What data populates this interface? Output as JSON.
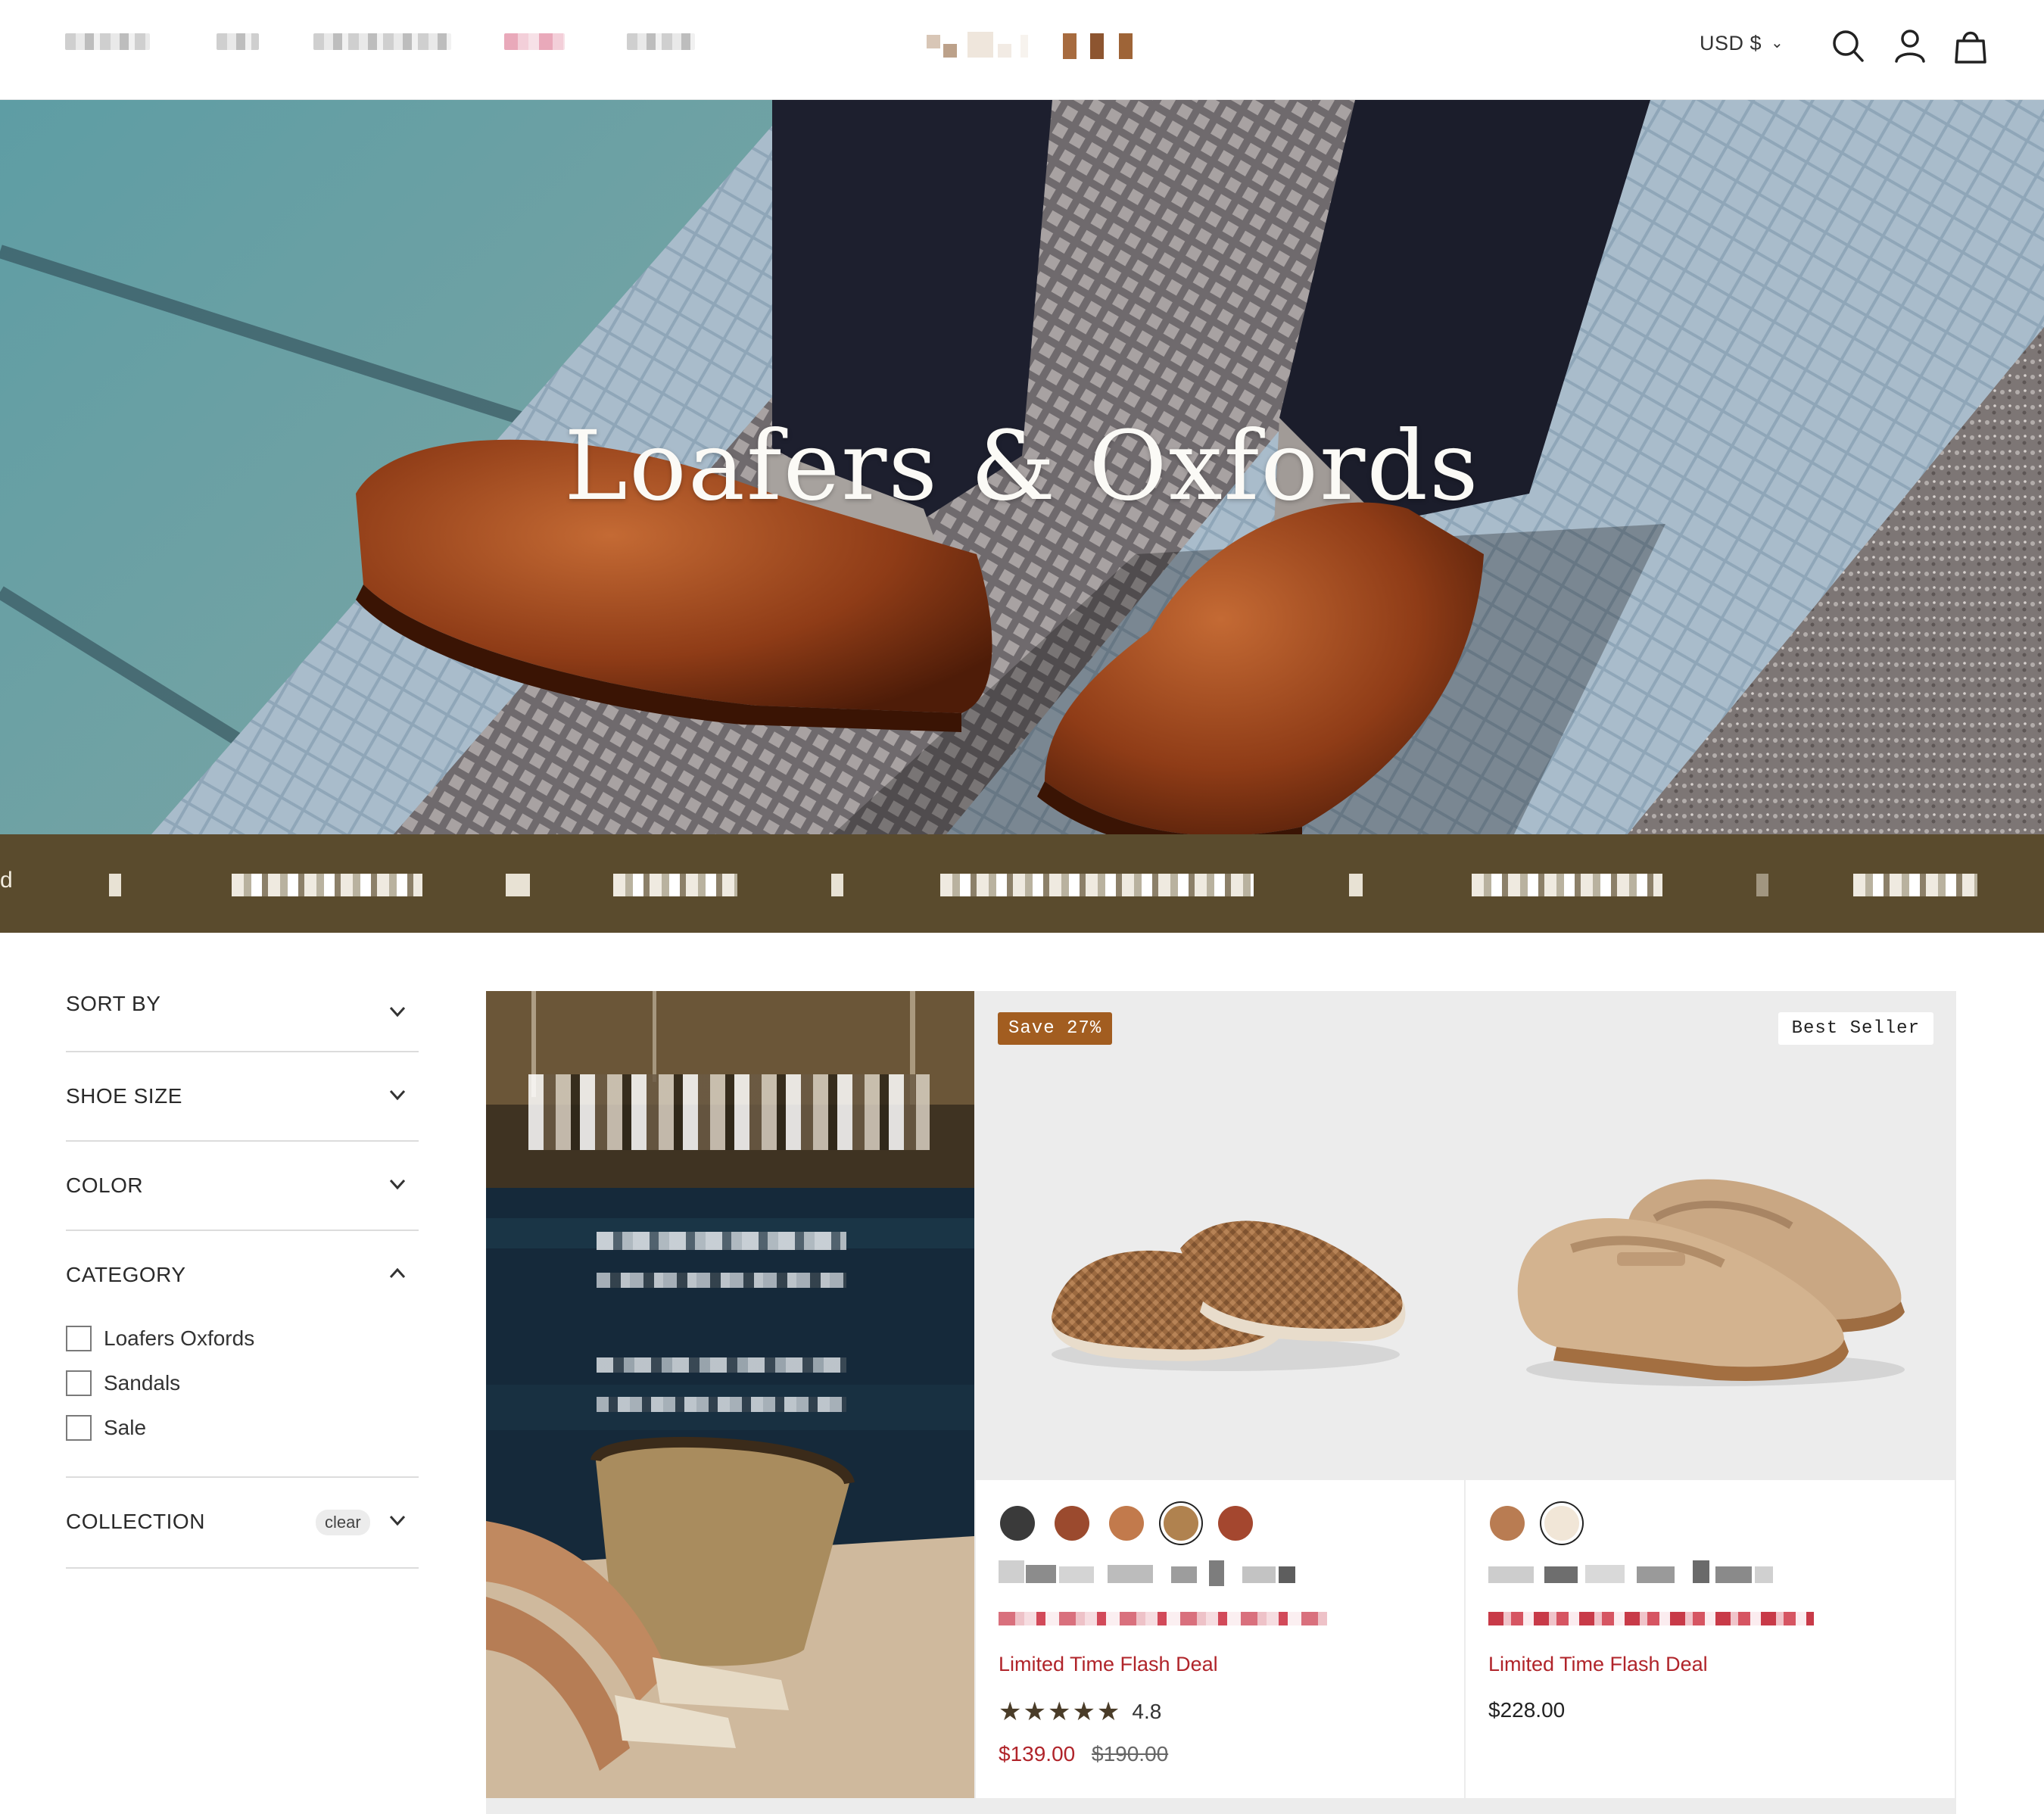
{
  "header": {
    "currency": "USD $",
    "nav_items": [
      "blurred-nav-1",
      "blurred-nav-2",
      "blurred-nav-3",
      "blurred-nav-4",
      "blurred-nav-5"
    ]
  },
  "hero": {
    "title": "Loafers & Oxfords"
  },
  "ticker": {
    "leading_char": "d"
  },
  "filters": {
    "sort_by": "SORT BY",
    "shoe_size": "SHOE SIZE",
    "color": "COLOR",
    "category": {
      "title": "CATEGORY",
      "options": [
        "Loafers Oxfords",
        "Sandals",
        "Sale"
      ]
    },
    "collection": {
      "title": "COLLECTION",
      "clear_label": "clear"
    }
  },
  "products": [
    {
      "badge": "Save 27%",
      "swatch_colors": [
        "#3a3a3a",
        "#9b4a2e",
        "#c27a4c",
        "#b0824f",
        "#a4472f"
      ],
      "selected_swatch": 3,
      "flash_label": "Limited Time Flash Deal",
      "rating": "4.8",
      "stars": "★★★★★",
      "sale_price": "$139.00",
      "original_price": "$190.00"
    },
    {
      "badge": "Best Seller",
      "swatch_colors": [
        "#b97c52",
        "#f1e6d7"
      ],
      "selected_swatch": 1,
      "flash_label": "Limited Time Flash Deal",
      "price": "$228.00"
    }
  ],
  "colors": {
    "ticker_bg": "#5a4b2d",
    "sale_red": "#b0242a",
    "save_badge": "#a25d20"
  }
}
